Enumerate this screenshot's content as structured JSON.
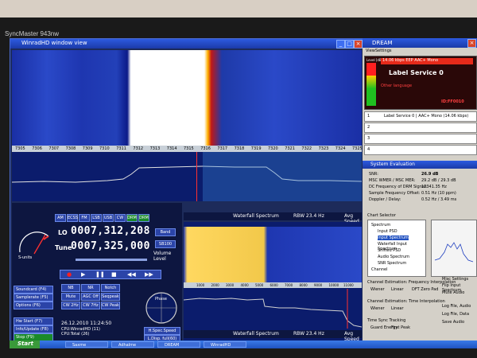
{
  "monitor": {
    "brand": "SyncMaster 943nw"
  },
  "winrad": {
    "title": "WinradHD window view",
    "freq_ticks": [
      "7305",
      "7306",
      "7307",
      "7308",
      "7309",
      "7310",
      "7311",
      "7312",
      "7313",
      "7314",
      "7315",
      "7316",
      "7317",
      "7318",
      "7319",
      "7320",
      "7321",
      "7322",
      "7323",
      "7324",
      "7325"
    ],
    "lo_label": "LO",
    "lo_value": "0007,312,208",
    "tune_label": "Tune",
    "tune_value": "0007,325,000",
    "band_btn": "Band",
    "sb_btn": "SB100",
    "volume_label": "Volume",
    "level_label": "Level",
    "mode_buttons": [
      "AM",
      "ECSS",
      "FM",
      "LSB",
      "USB",
      "CW",
      "DRM",
      "DRM"
    ],
    "side_buttons": [
      "Soundcard (F4)",
      "Samplerate (F5)",
      "Options (F6)",
      "Hw Start (F7)",
      "Info/Update (F8)",
      "Stop (F9)",
      "Minimize (F10)",
      "Exit (F11)"
    ],
    "dsp_buttons": [
      "NB",
      "NR",
      "Notch",
      "Mute",
      "AGC Off",
      "Seqpeak",
      "CW 2Hz",
      "CW 7Hz",
      "CW Peak"
    ],
    "smeter_label": "S-units",
    "date": "26.12.2010 11:24:50",
    "cpu1": "CPU:WinradHD (11)",
    "cpu2": "CPU:Total (26)",
    "phase_label": "Phase",
    "spec_speed_btn": "H.Spec.Speed",
    "disp_full_btn": "L.Disp. full(60)",
    "waterfall_label": "Waterfall Spectrum",
    "rbw_label": "RBW 23.4 Hz",
    "avg_label": "Avg Speed",
    "freq_ticks2": [
      "1000",
      "2000",
      "3000",
      "4000",
      "5000",
      "6000",
      "7000",
      "8000",
      "9000",
      "10000",
      "11000"
    ]
  },
  "dream": {
    "title": "DREAM",
    "menu": [
      "View",
      "Settings"
    ],
    "level_label": "Level [dB]",
    "bitrate": "14.06 kbps EEP AAC+ Mono",
    "service_label": "Label Service 0",
    "language": "Other language",
    "id": "ID:FF0010",
    "services": [
      {
        "num": "1",
        "text": "Label Service 0 | AAC+ Mono (14.06 kbps)"
      },
      {
        "num": "2",
        "text": ""
      },
      {
        "num": "3",
        "text": ""
      },
      {
        "num": "4",
        "text": ""
      }
    ]
  },
  "syseval": {
    "title": "System Evaluation",
    "rows": [
      {
        "label": "SNR:",
        "value": "26.9 dB"
      },
      {
        "label": "MSC WMER / MSC MER:",
        "value": "29.2 dB / 29.3 dB"
      },
      {
        "label": "DC Frequency of DRM Signal:",
        "value": "13341.35 Hz"
      },
      {
        "label": "Sample Frequency Offset:",
        "value": "0.51 Hz (10 ppm)"
      },
      {
        "label": "Doppler / Delay:",
        "value": "0.52 Hz / 3.49 ms"
      }
    ],
    "chart_selector": "Chart Selector",
    "tree": [
      "Spectrum",
      "Input PSD",
      "Input Spectrum",
      "Waterfall Input Spectrum",
      "Shifted PSD",
      "Audio Spectrum",
      "SNR Spectrum",
      "Channel"
    ],
    "freq_interp_title": "Channel Estimation: Frequency Interpolation",
    "freq_interp_opts": [
      "Wiener",
      "Linear",
      "DFT Zero Pad"
    ],
    "time_interp_title": "Channel Estimation: Time Interpolation",
    "time_interp_opts": [
      "Wiener",
      "Linear"
    ],
    "time_sync_title": "Time Sync Tracking",
    "time_sync_opts": [
      "Guard Energy",
      "First Peak"
    ],
    "misc_title": "Misc Settings",
    "misc_opts": [
      "Flip Input Spectrum",
      "Mute Audio"
    ],
    "log_opts": [
      "Log File, Audio",
      "Log File, Data",
      "Save Audio"
    ]
  },
  "taskbar": {
    "start": "Start",
    "tasks": [
      "Saxme",
      "Adhalme",
      "DREAM",
      "WinradHD"
    ]
  },
  "colors": {
    "screen_blue": "#0a2a8a",
    "title_blue": "#2d5ae0",
    "accent_red": "#ff2020"
  }
}
